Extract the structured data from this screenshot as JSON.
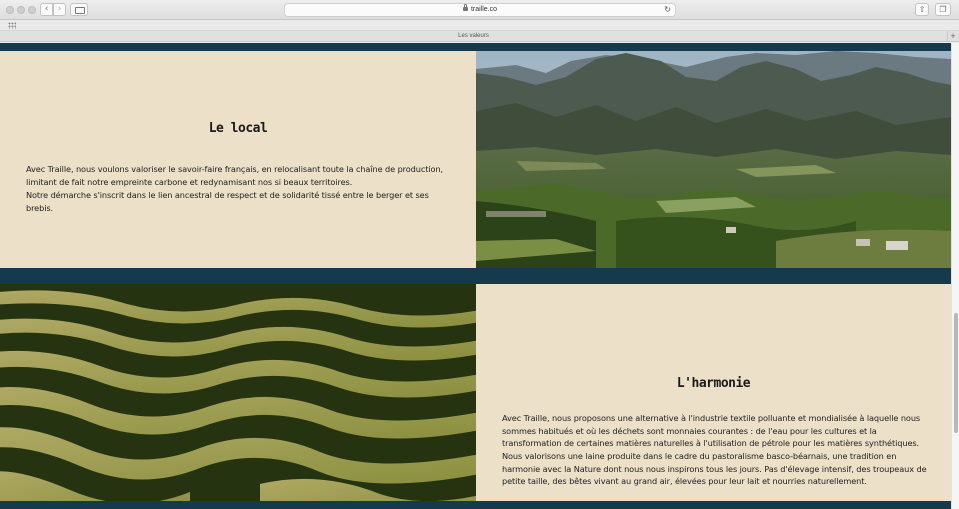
{
  "browser": {
    "url": "traille.co",
    "tab_title": "Les valeurs",
    "back_icon": "‹",
    "forward_icon": "›",
    "reload_icon": "↻",
    "new_tab_icon": "+"
  },
  "sections": {
    "local": {
      "heading": "Le local",
      "paragraphs": [
        "Avec Traille, nous voulons valoriser le savoir-faire français, en relocalisant toute la chaîne de production, limitant de fait notre empreinte carbone et redynamisant nos si beaux territoires.",
        "Notre démarche s'inscrit dans le lien ancestral de respect et de solidarité tissé entre le berger et ses brebis."
      ]
    },
    "harmonie": {
      "heading": "L'harmonie",
      "paragraphs": [
        "Avec Traille, nous proposons une alternative à l'industrie textile polluante et mondialisée à laquelle nous sommes habitués et où les déchets sont monnaies courantes : de l'eau pour les cultures et la transformation de certaines matières naturelles à l'utilisation de pétrole pour les matières synthétiques.",
        "Nous valorisons une laine produite dans le cadre du pastoralisme basco-béarnais, une tradition en harmonie avec la Nature dont nous nous inspirons tous les jours. Pas d'élevage intensif, des troupeaux de petite taille, des bêtes vivant au grand air, élevées pour leur lait et nourries naturellement."
      ]
    }
  },
  "colors": {
    "band": "#15394d",
    "panel": "#ece0c8",
    "text": "#222222"
  }
}
